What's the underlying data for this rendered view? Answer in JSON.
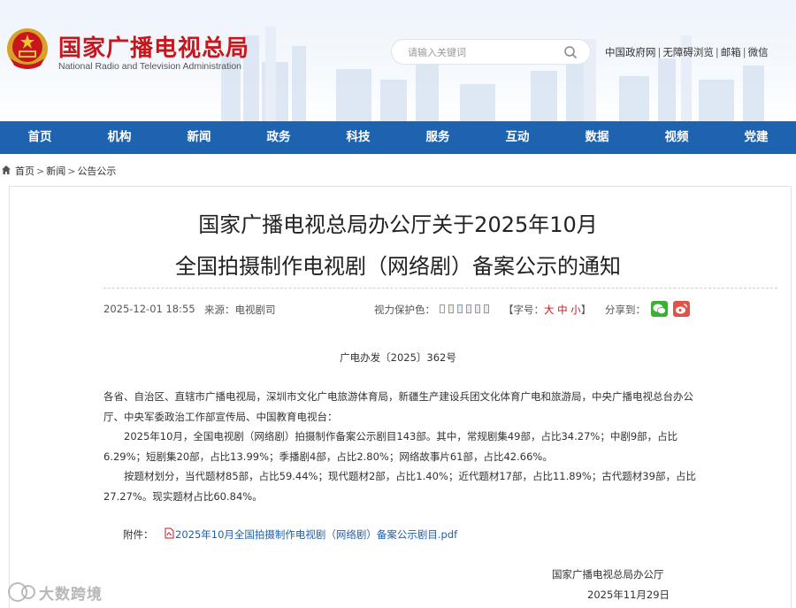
{
  "header": {
    "brand_cn": "国家广播电视总局",
    "brand_en": "National Radio and Television Administration",
    "search_placeholder": "请输入关键词",
    "links": [
      "中国政府网",
      "无障碍浏览",
      "邮箱",
      "微信"
    ],
    "link_separator": "|"
  },
  "nav": {
    "items": [
      "首页",
      "机构",
      "新闻",
      "政务",
      "科技",
      "服务",
      "互动",
      "数据",
      "视频",
      "党建"
    ]
  },
  "breadcrumb": {
    "items": [
      "首页",
      "新闻",
      "公告公示"
    ],
    "separator": ">"
  },
  "article": {
    "title_line1": "国家广播电视总局办公厅关于2025年10月",
    "title_line2": "全国拍摄制作电视剧（网络剧）备案公示的通知",
    "date": "2025-12-01 18:55",
    "source": "来源：电视剧司",
    "vision_label": "视力保护色：",
    "vision_colors": [
      "#fafafa",
      "#e9f3dc",
      "#dcecf8",
      "#ece6f6",
      "#f5e4ec",
      "#ececec"
    ],
    "font_label_open": "【字号：",
    "font_sizes": "大 中 小",
    "font_label_close": "】",
    "share_label": "分享到：",
    "doc_number": "广电办发〔2025〕362号",
    "para1": "各省、自治区、直辖市广播电视局，深圳市文化广电旅游体育局，新疆生产建设兵团文化体育广电和旅游局，中央广播电视总台办公厅、中央军委政治工作部宣传局、中国教育电视台：",
    "para2": "2025年10月，全国电视剧（网络剧）拍摄制作备案公示剧目143部。其中，常规剧集49部，占比34.27%；中剧9部，占比6.29%；短剧集20部，占比13.99%；季播剧4部，占比2.80%；网络故事片61部，占比42.66%。",
    "para3": "按题材划分，当代题材85部，占比59.44%；现代题材2部，占比1.40%；近代题材17部，占比11.89%；古代题材39部，占比27.27%。现实题材占比60.84%。",
    "attachment_label": "附件：",
    "attachment_link": "2025年10月全国拍摄制作电视剧（网络剧）备案公示剧目.pdf",
    "signature_org": "国家广播电视总局办公厅",
    "signature_date": "2025年11月29日"
  },
  "watermark": {
    "text": "大数跨境"
  },
  "colors": {
    "nav_blue": "#1d63b0",
    "brand_red": "#c8161d",
    "link_blue": "#1d5fb0"
  }
}
